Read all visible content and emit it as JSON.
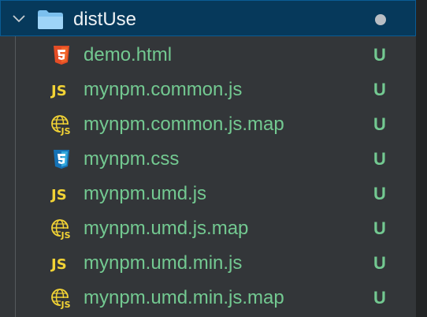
{
  "folder": {
    "name": "distUse",
    "icon": "folder-icon",
    "expanded": true,
    "badge": "modified-dot"
  },
  "files": [
    {
      "name": "demo.html",
      "icon": "html5-icon",
      "status": "U"
    },
    {
      "name": "mynpm.common.js",
      "icon": "javascript-icon",
      "status": "U"
    },
    {
      "name": "mynpm.common.js.map",
      "icon": "js-map-icon",
      "status": "U"
    },
    {
      "name": "mynpm.css",
      "icon": "css3-icon",
      "status": "U"
    },
    {
      "name": "mynpm.umd.js",
      "icon": "javascript-icon",
      "status": "U"
    },
    {
      "name": "mynpm.umd.js.map",
      "icon": "js-map-icon",
      "status": "U"
    },
    {
      "name": "mynpm.umd.min.js",
      "icon": "javascript-icon",
      "status": "U"
    },
    {
      "name": "mynpm.umd.min.js.map",
      "icon": "js-map-icon",
      "status": "U"
    }
  ],
  "colors": {
    "untracked": "#73c991",
    "selection": "#06395b",
    "background": "#333639",
    "js_yellow": "#f2d335",
    "html_orange": "#e44d26",
    "css_blue": "#1572b6"
  }
}
